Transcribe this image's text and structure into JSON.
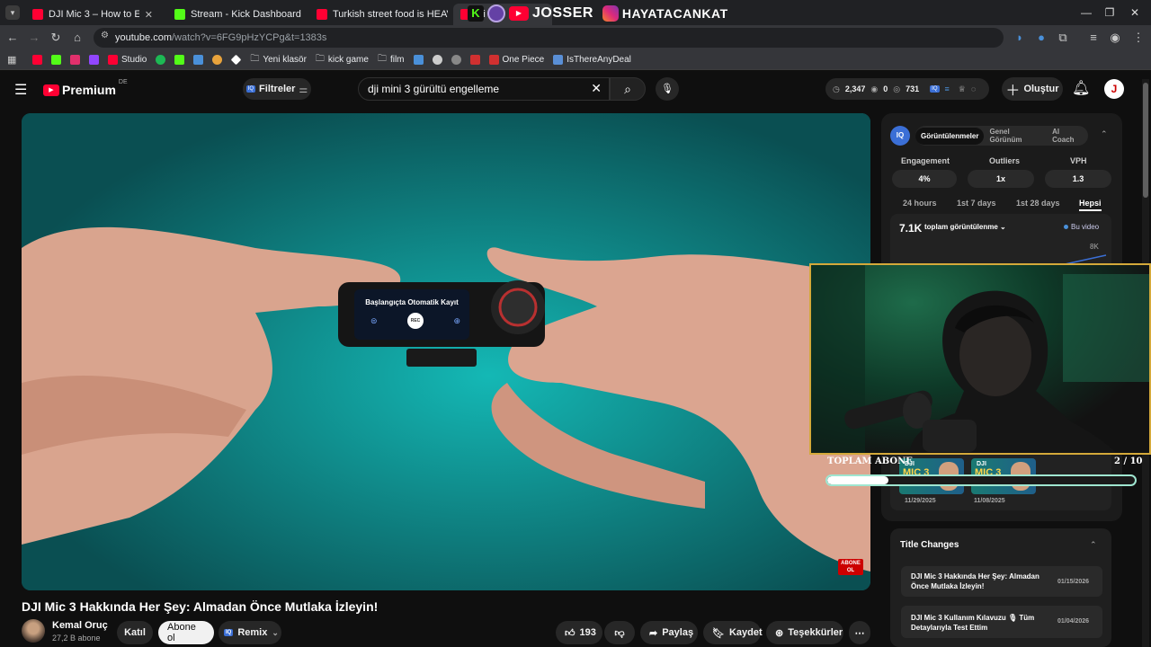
{
  "browser": {
    "tabs": [
      {
        "title": "DJI Mic 3 – How to Enable or Di",
        "favicon_color": "#ff0033"
      },
      {
        "title": "Stream - Kick Dashboard",
        "favicon_color": "#53fc18"
      },
      {
        "title": "Turkish street food is HEAVEN",
        "favicon_color": "#ff0033"
      },
      {
        "title": "Ai",
        "favicon_color": "#ff0033"
      }
    ],
    "overlay_banner": {
      "left_text": "JOSSER",
      "right_text": "HAYATACANKAT"
    },
    "url": "youtube.com/watch?v=6FG9pHzYCPg&t=1383s",
    "url_host": "youtube.com",
    "url_rest": "/watch?v=6FG9pHzYCPg&t=1383s",
    "bookmarks": [
      {
        "label": "",
        "color": "#ff0033"
      },
      {
        "label": "",
        "color": "#53fc18"
      },
      {
        "label": "",
        "color": "#e1306c"
      },
      {
        "label": "",
        "color": "#9146ff"
      },
      {
        "label": "Studio",
        "color": "#ff0033"
      },
      {
        "label": "",
        "color": "#1db954"
      },
      {
        "label": "",
        "color": "#53fc18"
      },
      {
        "label": "",
        "color": "#4a90d9"
      },
      {
        "label": "",
        "color": "#e8a33c"
      },
      {
        "label": "",
        "color": "#ffffff"
      },
      {
        "label": "Yeni klasör",
        "color": "folder"
      },
      {
        "label": "kick game",
        "color": "folder"
      },
      {
        "label": "film",
        "color": "folder"
      },
      {
        "label": "",
        "color": "#4a90d9"
      },
      {
        "label": "",
        "color": "#cccccc"
      },
      {
        "label": "",
        "color": "#888888"
      },
      {
        "label": "",
        "color": "#d03030"
      },
      {
        "label": "One Piece",
        "color": "#d03030"
      },
      {
        "label": "IsThereAnyDeal",
        "color": "#5a8fd6"
      }
    ]
  },
  "youtube": {
    "logo_text": "Premium",
    "logo_region": "DE",
    "filters_label": "Filtreler",
    "search_value": "dji mini 3 gürültü engelleme",
    "header_stats": {
      "views": "2,347",
      "zero": "0",
      "count": "731"
    },
    "create_label": "Oluştur",
    "avatar_letter": "J"
  },
  "video": {
    "screen_text": "Başlangıçta Otomatik Kayıt",
    "rec_label": "REC",
    "subscribe_badge": "ABONE OL",
    "title": "DJI Mic 3 Hakkında Her Şey: Almadan Önce Mutlaka İzleyin!",
    "channel": "Kemal Oruç",
    "subscribers": "27,2 B abone",
    "join_label": "Katıl",
    "subscribe_label": "Abone ol",
    "remix_label": "Remix",
    "likes": "193",
    "share_label": "Paylaş",
    "save_label": "Kaydet",
    "thanks_label": "Teşekkürler"
  },
  "panel": {
    "tabs": [
      "Görüntülenmeler",
      "Genel Görünüm",
      "AI Coach"
    ],
    "stats_labels": [
      "Engagement",
      "Outliers",
      "VPH"
    ],
    "stats_values": [
      "4%",
      "1x",
      "1.3"
    ],
    "ranges": [
      "24 hours",
      "1st 7 days",
      "1st 28 days",
      "Hepsi"
    ],
    "total_views": "7.1K",
    "total_label": "toplam görüntülenme",
    "legend": "Bu video",
    "axis_top": "8K",
    "thumbs": [
      {
        "line1": "DJI",
        "line2": "MIC 3",
        "date": "11/29/2025"
      },
      {
        "line1": "DJI",
        "line2": "MIC 3",
        "date": "11/08/2025"
      }
    ],
    "title_changes_label": "Title Changes",
    "title_changes": [
      {
        "title": "DJI Mic 3 Hakkında Her Şey: Almadan Önce Mutlaka İzleyin!",
        "date": "01/15/2026"
      },
      {
        "title": "DJI Mic 3 Kullanım Kılavuzu 🎙 Tüm Detaylarıyla Test Ettim",
        "date": "01/04/2026"
      }
    ]
  },
  "webcam": {
    "goal_label": "TOPLAM ABONE",
    "goal_value": "2 / 10",
    "goal_progress": 0.2
  },
  "colors": {
    "accent_red": "#ff0033",
    "gold_border": "#d4a93a",
    "iq_blue": "#3b6fd6"
  }
}
